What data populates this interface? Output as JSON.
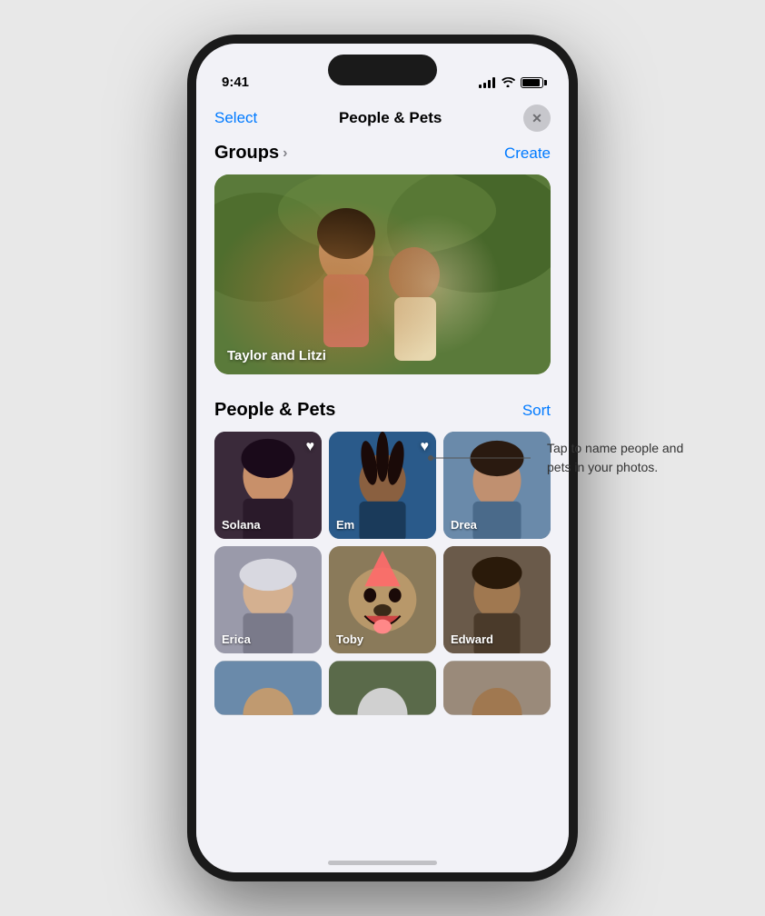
{
  "statusBar": {
    "time": "9:41",
    "signalBars": 4,
    "wifiOn": true,
    "batteryFull": true
  },
  "navBar": {
    "selectLabel": "Select",
    "title": "People & Pets",
    "closeAriaLabel": "Close"
  },
  "groups": {
    "sectionTitle": "Groups",
    "createLabel": "Create",
    "card": {
      "label": "Taylor and Litzi"
    }
  },
  "peoplePets": {
    "sectionTitle": "People & Pets",
    "sortLabel": "Sort",
    "people": [
      {
        "name": "Solana",
        "favorited": true,
        "photoClass": "photo-solana"
      },
      {
        "name": "Em",
        "favorited": true,
        "photoClass": "photo-em"
      },
      {
        "name": "Drea",
        "favorited": false,
        "photoClass": "photo-drea"
      },
      {
        "name": "Erica",
        "favorited": false,
        "photoClass": "photo-erica"
      },
      {
        "name": "Toby",
        "favorited": false,
        "photoClass": "photo-toby"
      },
      {
        "name": "Edward",
        "favorited": false,
        "photoClass": "photo-edward"
      }
    ],
    "partialPeople": [
      {
        "photoClass": "photo-partial1"
      },
      {
        "photoClass": "photo-partial2"
      },
      {
        "photoClass": "photo-partial3"
      }
    ]
  },
  "annotation": {
    "text": "Tap to name people\nand pets in your photos."
  }
}
